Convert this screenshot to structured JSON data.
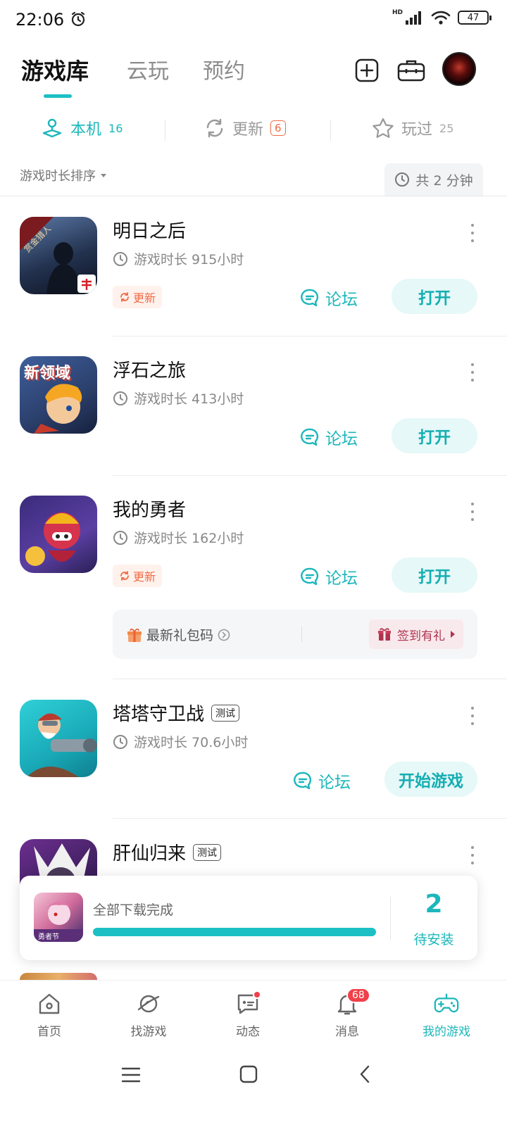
{
  "status_bar": {
    "time": "22:06",
    "battery": "47",
    "network": "HD"
  },
  "header": {
    "tabs": [
      {
        "label": "游戏库",
        "active": true
      },
      {
        "label": "云玩",
        "active": false
      },
      {
        "label": "预约",
        "active": false
      }
    ]
  },
  "sub_tabs": {
    "local": {
      "label": "本机",
      "count": "16"
    },
    "update": {
      "label": "更新",
      "count": "6"
    },
    "played": {
      "label": "玩过",
      "count": "25"
    }
  },
  "sort": {
    "label": "游戏时长排序",
    "total_time": "共 2 分钟"
  },
  "colors": {
    "accent": "#1cb7bb",
    "update": "#f06a45",
    "badge_red": "#f0404a"
  },
  "games": [
    {
      "name": "明日之后",
      "time": "游戏时长 915小时",
      "update_tag": "更新",
      "forum": "论坛",
      "action": "打开",
      "icon_badge": "赏金猎人"
    },
    {
      "name": "浮石之旅",
      "time": "游戏时长 413小时",
      "forum": "论坛",
      "action": "打开",
      "icon_badge": "新领域"
    },
    {
      "name": "我的勇者",
      "time": "游戏时长 162小时",
      "update_tag": "更新",
      "forum": "论坛",
      "action": "打开",
      "gift": {
        "code_label": "最新礼包码",
        "checkin_label": "签到有礼"
      }
    },
    {
      "name": "塔塔守卫战",
      "tag": "测试",
      "time": "游戏时长 70.6小时",
      "forum": "论坛",
      "action": "开始游戏"
    },
    {
      "name": "肝仙归来",
      "tag": "测试"
    }
  ],
  "download_card": {
    "text": "全部下载完成",
    "progress": 1.0,
    "count": "2",
    "count_label": "待安装",
    "thumb_text": "勇者节"
  },
  "bottom_nav": {
    "items": [
      {
        "label": "首页",
        "icon": "home-icon"
      },
      {
        "label": "找游戏",
        "icon": "planet-icon"
      },
      {
        "label": "动态",
        "icon": "chat-icon",
        "dot": true
      },
      {
        "label": "消息",
        "icon": "bell-icon",
        "badge": "68"
      },
      {
        "label": "我的游戏",
        "icon": "gamepad-icon",
        "active": true
      }
    ]
  }
}
